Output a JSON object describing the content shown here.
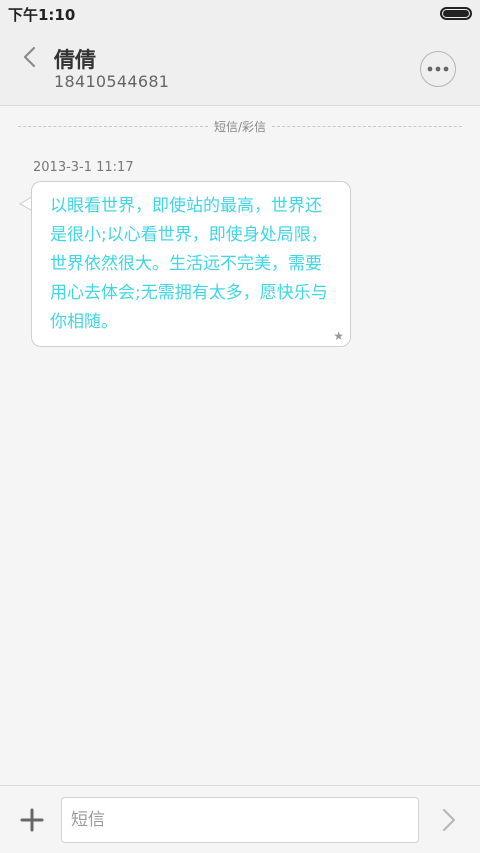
{
  "status_bar": {
    "time": "下午1:10"
  },
  "header": {
    "contact_name": "倩倩",
    "contact_number": "18410544681"
  },
  "thread": {
    "separator_label": "短信/彩信",
    "messages": [
      {
        "timestamp": "2013-3-1 11:17",
        "text": "以眼看世界，即使站的最高，世界还是很小;以心看世界，即使身处局限，世界依然很大。生活远不完美，需要用心去体会;无需拥有太多，愿快乐与你相随。",
        "starred_icon": "★"
      }
    ]
  },
  "composer": {
    "placeholder": "短信",
    "value": ""
  },
  "icons": {
    "back": "back-chevron-icon",
    "more": "more-dots-icon",
    "add": "plus-icon",
    "send": "send-chevron-icon",
    "star": "star-icon",
    "battery": "battery-icon"
  },
  "colors": {
    "message_text": "#3fd6e6",
    "header_bg": "#efefef",
    "page_bg": "#f5f5f5"
  }
}
